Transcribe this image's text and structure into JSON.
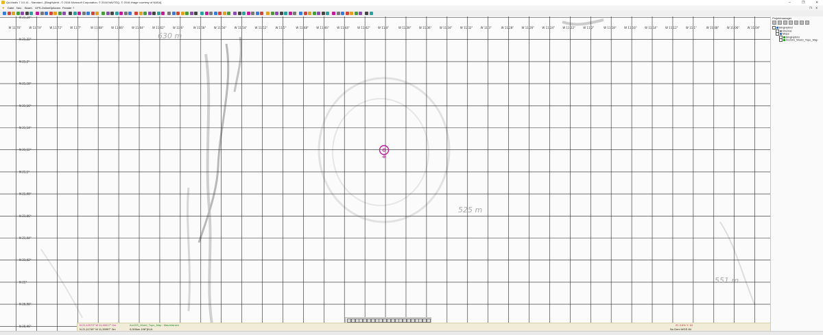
{
  "window": {
    "title": "QuoVadis 7.3.0.41 - Standard - [BingHybrid - © 2018 Microsoft Corporation, © 2018 NAVTEQ, © 2018 Image courtesy of NASA]",
    "controls": [
      "–",
      "❐",
      "✕"
    ]
  },
  "menu": {
    "items": [
      "Datei",
      "Neu",
      "Bearb.",
      "GPS-Online",
      "Optionen",
      "Fenster",
      "?"
    ]
  },
  "map": {
    "lon_labels": [
      "W 11,76°",
      "W 11,74°",
      "W 11,72°",
      "W 11,7°",
      "W 11,68°",
      "W 11,66°",
      "W 11,64°",
      "W 11,62°",
      "W 11,6°",
      "W 11,58°",
      "W 11,56°",
      "W 11,54°",
      "W 11,52°",
      "W 11,5°",
      "W 11,48°",
      "W 11,46°",
      "W 11,44°",
      "W 11,42°",
      "W 11,4°",
      "W 11,38°",
      "W 11,36°",
      "W 11,34°",
      "W 11,32°",
      "W 11,3°",
      "W 11,28°",
      "W 11,26°",
      "W 11,24°",
      "W 11,22°",
      "W 11,2°",
      "W 11,18°",
      "W 11,16°",
      "W 11,14°",
      "W 11,12°",
      "W 11,1°",
      "W 11,08°",
      "W 11,06°",
      "W 11,04°"
    ],
    "lat_labels": [
      "N 21,24°",
      "N 21,22°",
      "N 21,2°",
      "N 21,18°",
      "N 21,16°",
      "N 21,14°",
      "N 21,12°",
      "N 21,1°",
      "N 21,08°",
      "N 21,06°",
      "N 21,04°",
      "N 21,02°",
      "N 21°",
      "N 20,98°",
      "N 20,96°"
    ],
    "elevations": [
      "630 m",
      "525 m",
      "551 m"
    ]
  },
  "status": {
    "coord_pink": "N 21,12073° W 11,40017° 0m",
    "coord_black": "N 21,11749° W 11,39997° 0m",
    "layer": "ArcGIS_World_Topo_Map : Mauretanien",
    "distance": "0,000km 108°(KUL",
    "right_red": "ZI: 2,6% Y: 10",
    "right_black": "No Dem  WGS 84"
  },
  "panel": {
    "title": "Projektmanager",
    "tree": [
      {
        "label": "BingHybrid",
        "level": 0,
        "color": "#2a6bd0"
      },
      {
        "label": "Internal",
        "level": 1,
        "color": "#888888"
      },
      {
        "label": "Maps",
        "level": 1,
        "color": "#2a6bd0"
      },
      {
        "label": "BingHybrid",
        "level": 2,
        "color": "#2a9b2a"
      },
      {
        "label": "ArcGIS_World_Topo_Map",
        "level": 2,
        "color": "#2a9b2a"
      }
    ]
  },
  "colors": {
    "marker": "#c21a9a",
    "grid": "#222222",
    "statusbg": "#f0ecd8"
  }
}
